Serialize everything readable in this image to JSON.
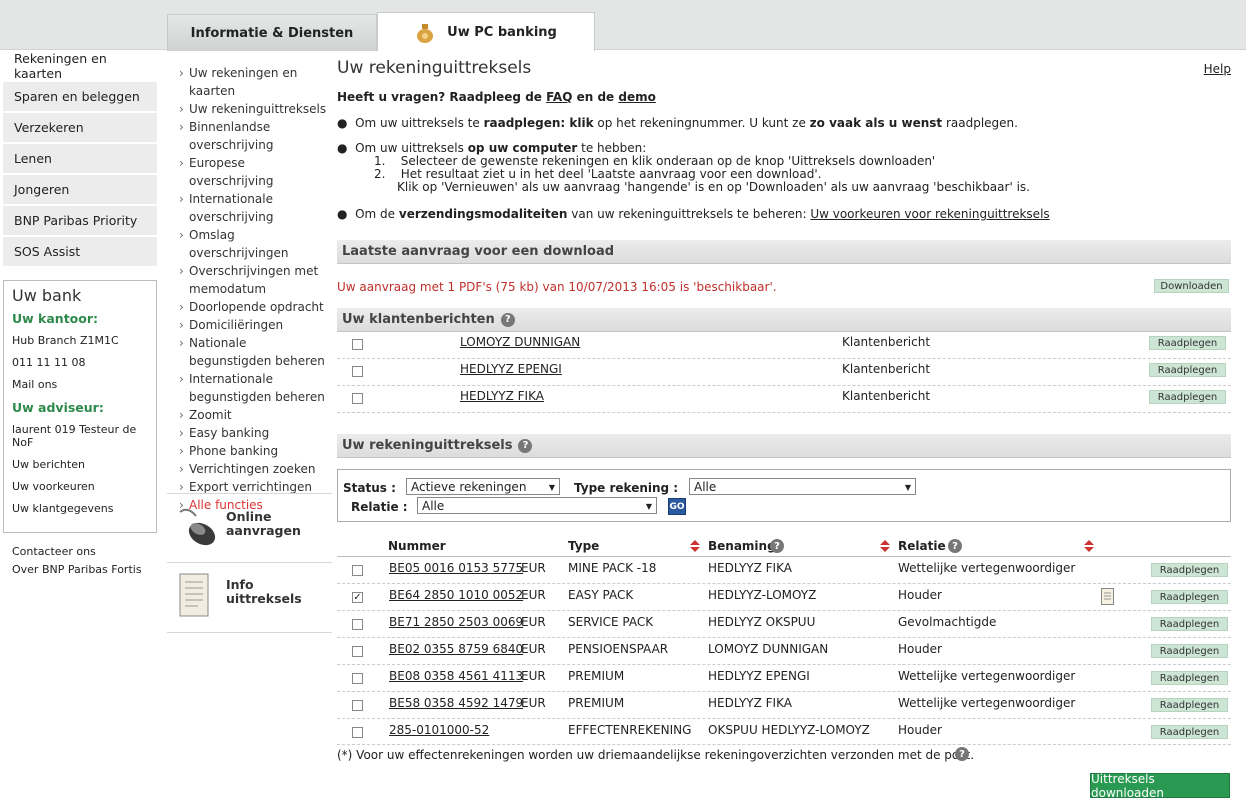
{
  "tabs": {
    "info": "Informatie & Diensten",
    "pc": "Uw PC banking"
  },
  "leftnav": [
    "Rekeningen en kaarten",
    "Sparen en beleggen",
    "Verzekeren",
    "Lenen",
    "Jongeren",
    "BNP Paribas Priority",
    "SOS Assist"
  ],
  "uwbank": {
    "title": "Uw bank",
    "kantoor_label": "Uw kantoor:",
    "branch": "Hub Branch Z1M1C",
    "phone": "011 11 11 08",
    "mail": "Mail ons",
    "adviseur_label": "Uw adviseur:",
    "adviseur": "laurent 019 Testeur de NoF",
    "berichten": "Uw berichten",
    "voorkeuren": "Uw voorkeuren",
    "klantgegevens": "Uw klantgegevens"
  },
  "leftfoot": {
    "contact": "Contacteer ons",
    "over": "Over BNP Paribas Fortis"
  },
  "midnav": [
    "Uw rekeningen en kaarten",
    "Uw rekeninguittreksels",
    "Binnenlandse overschrijving",
    "Europese overschrijving",
    "Internationale overschrijving",
    "Omslag overschrijvingen",
    "Overschrijvingen met memodatum",
    "Doorlopende opdracht",
    "Domiciliëringen",
    "Nationale begunstigden beheren",
    "Internationale begunstigden beheren",
    "Zoomit",
    "Easy banking",
    "Phone banking",
    "Verrichtingen zoeken",
    "Export verrichtingen",
    "Alle functies"
  ],
  "promos": {
    "online": "Online aanvragen",
    "info": "Info uittreksels"
  },
  "main": {
    "title": "Uw rekeninguittreksels",
    "help": "Help",
    "faq_pre": "Heeft u vragen? Raadpleeg de ",
    "faq": "FAQ",
    "faq_mid": " en de ",
    "demo": "demo",
    "b1_a": "Om uw uittreksels te ",
    "b1_b": "raadplegen",
    "b1_c": ": ",
    "b1_d": "klik",
    "b1_e": " op het rekeningnummer. U kunt ze ",
    "b1_f": "zo vaak als u wenst",
    "b1_g": " raadplegen.",
    "b2_a": "Om uw uittreksels ",
    "b2_b": "op uw computer",
    "b2_c": " te hebben:",
    "step1": "Selecteer de gewenste rekeningen en klik onderaan op de knop 'Uittreksels downloaden'",
    "step2a": "Het resultaat ziet u in het deel 'Laatste aanvraag voor een download'.",
    "step2b": "Klik op 'Vernieuwen' als uw aanvraag 'hangende' is en op 'Downloaden' als uw aanvraag 'beschikbaar' is.",
    "b3_a": "Om de ",
    "b3_b": "verzendingsmodaliteiten",
    "b3_c": " van uw rekeninguittreksels te beheren: ",
    "b3_link": "Uw voorkeuren voor rekeninguittreksels"
  },
  "download": {
    "header": "Laatste aanvraag voor een download",
    "status": "Uw aanvraag met 1 PDF's (75 kb) van 10/07/2013 16:05 is 'beschikbaar'.",
    "button": "Downloaden"
  },
  "klanten": {
    "header": "Uw klantenberichten",
    "rows": [
      {
        "name": "LOMOYZ DUNNIGAN",
        "type": "Klantenbericht",
        "btn": "Raadplegen"
      },
      {
        "name": "HEDLYYZ EPENGI",
        "type": "Klantenbericht",
        "btn": "Raadplegen"
      },
      {
        "name": "HEDLYYZ FIKA",
        "type": "Klantenbericht",
        "btn": "Raadplegen"
      }
    ]
  },
  "uittreksels": {
    "header": "Uw rekeninguittreksels",
    "status_label": "Status :",
    "status_value": "Actieve rekeningen",
    "type_label": "Type rekening :",
    "type_value": "Alle",
    "relatie_label": "Relatie :",
    "relatie_value": "Alle",
    "go": "GO",
    "cols": {
      "nummer": "Nummer",
      "type": "Type",
      "benaming": "Benaming",
      "relatie": "Relatie"
    },
    "rows": [
      {
        "nr": "BE05 0016 0153 5775",
        "cur": "EUR",
        "type": "MINE PACK -18",
        "ben": "HEDLYYZ FIKA",
        "rel": "Wettelijke vertegenwoordiger",
        "checked": "",
        "btn": "Raadplegen"
      },
      {
        "nr": "BE64 2850 1010 0052",
        "cur": "EUR",
        "type": "EASY PACK",
        "ben": "HEDLYYZ-LOMOYZ",
        "rel": "Houder",
        "checked": "✓",
        "btn": "Raadplegen"
      },
      {
        "nr": "BE71 2850 2503 0069",
        "cur": "EUR",
        "type": "SERVICE PACK",
        "ben": "HEDLYYZ OKSPUU",
        "rel": "Gevolmachtigde",
        "checked": "",
        "btn": "Raadplegen"
      },
      {
        "nr": "BE02 0355 8759 6840",
        "cur": "EUR",
        "type": "PENSIOENSPAAR",
        "ben": "LOMOYZ DUNNIGAN",
        "rel": "Houder",
        "checked": "",
        "btn": "Raadplegen"
      },
      {
        "nr": "BE08 0358 4561 4113",
        "cur": "EUR",
        "type": "PREMIUM",
        "ben": "HEDLYYZ EPENGI",
        "rel": "Wettelijke vertegenwoordiger",
        "checked": "",
        "btn": "Raadplegen"
      },
      {
        "nr": "BE58 0358 4592 1479",
        "cur": "EUR",
        "type": "PREMIUM",
        "ben": "HEDLYYZ FIKA",
        "rel": "Wettelijke vertegenwoordiger",
        "checked": "",
        "btn": "Raadplegen"
      },
      {
        "nr": "285-0101000-52",
        "cur": "",
        "type": "EFFECTENREKENING",
        "ben": "OKSPUU HEDLYYZ-LOMOYZ",
        "rel": "Houder",
        "checked": "",
        "btn": "Raadplegen"
      }
    ],
    "footnote": "(*) Voor uw effectenrekeningen worden uw driemaandelijkse rekeningoverzichten verzonden met de post.",
    "download_btn": "Uittreksels downloaden"
  }
}
